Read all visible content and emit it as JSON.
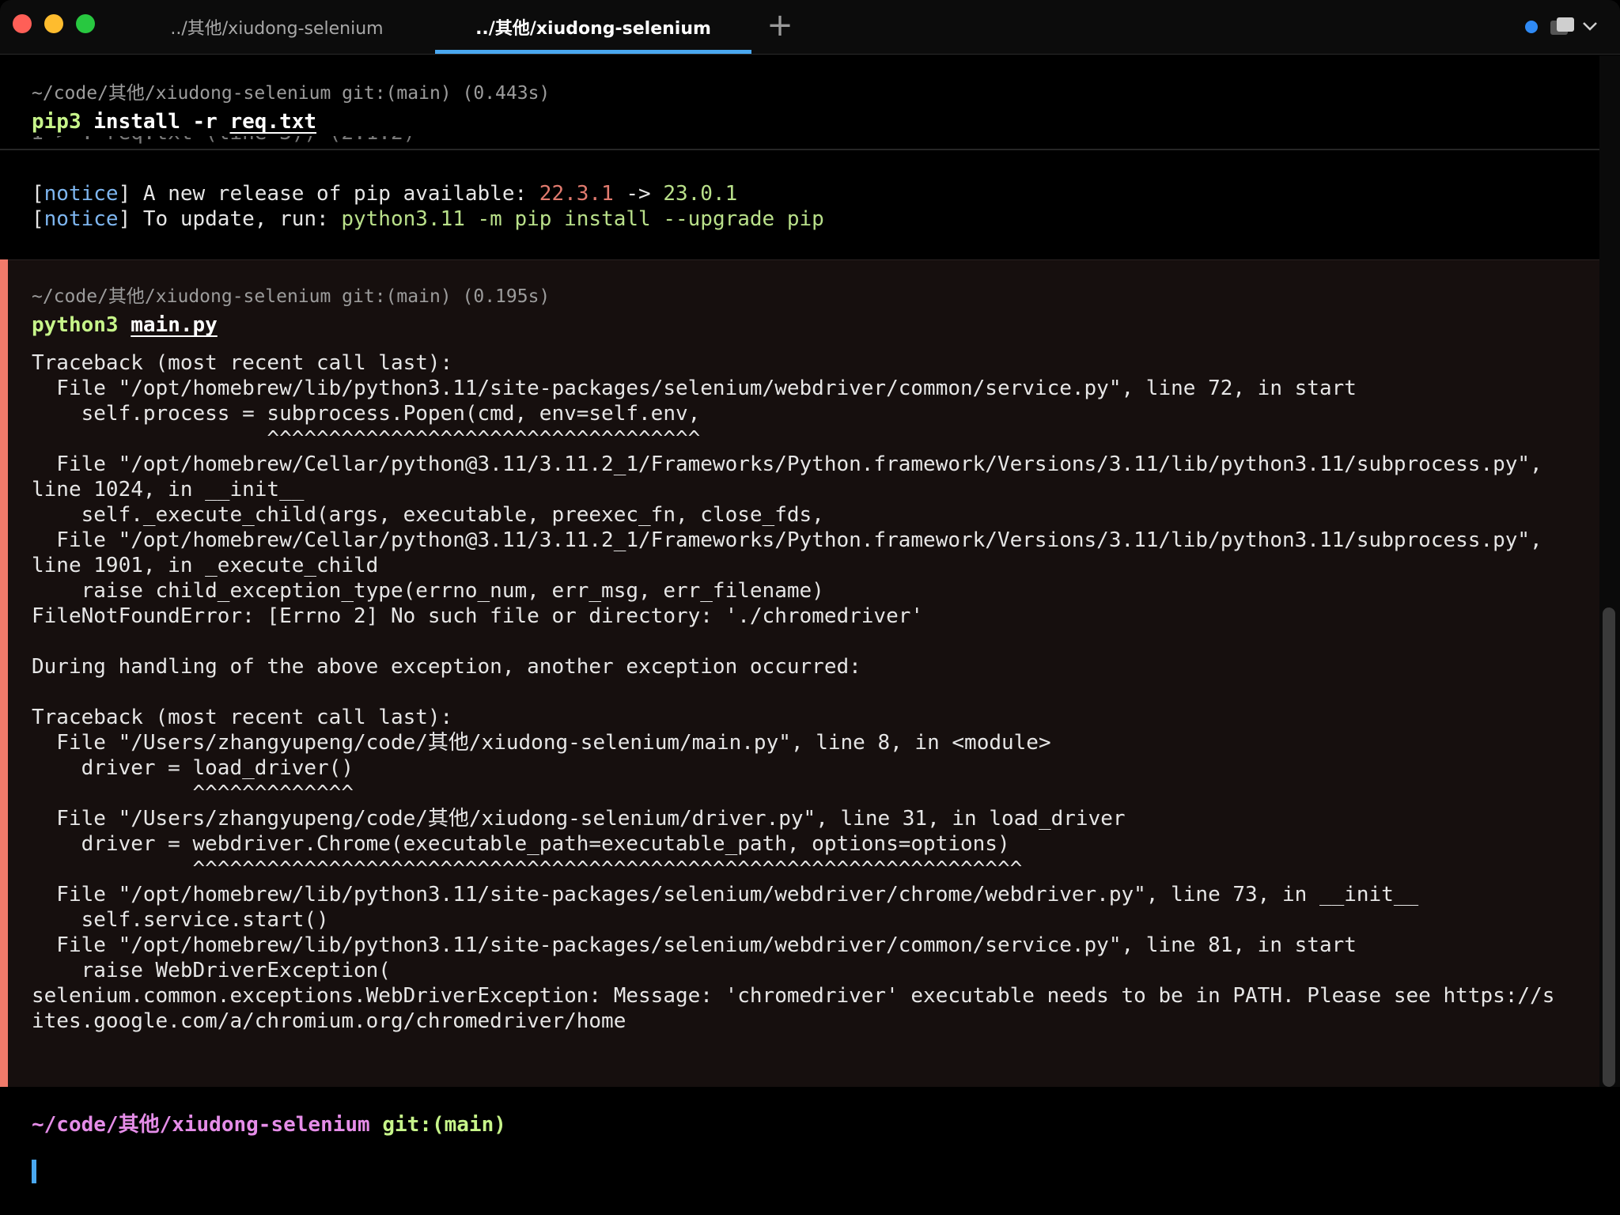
{
  "tabs": [
    {
      "label": "../其他/xiudong-selenium",
      "active": false
    },
    {
      "label": "../其他/xiudong-selenium",
      "active": true
    }
  ],
  "colors": {
    "error_bar": "#f07a6a",
    "active_tab_indicator": "#4aa8f0",
    "command": "#c7f58a",
    "prompt_path": "#e58de8"
  },
  "icons": {
    "new_tab": "+",
    "status_dot": "blue-dot-icon",
    "window_menu": "window-stack-icon",
    "dropdown": "chevron-down-icon"
  },
  "block1": {
    "meta": "~/code/其他/xiudong-selenium git:(main) (0.443s)",
    "cmd_name": "pip3",
    "cmd_args": "install -r",
    "cmd_file": "req.txt",
    "clipped_text": "I > : req.txt (line 3)) (2.1.2)",
    "notice1_prefix": "A new release of pip available: ",
    "notice_tag": "notice",
    "old_version": "22.3.1",
    "arrow": "->",
    "new_version": "23.0.1",
    "notice2_prefix": "To update, run: ",
    "update_cmd": "python3.11 -m pip install --upgrade pip"
  },
  "block2": {
    "meta": "~/code/其他/xiudong-selenium git:(main) (0.195s)",
    "cmd_name": "python3",
    "cmd_file": "main.py",
    "lines": [
      "Traceback (most recent call last):",
      "  File \"/opt/homebrew/lib/python3.11/site-packages/selenium/webdriver/common/service.py\", line 72, in start",
      "    self.process = subprocess.Popen(cmd, env=self.env,",
      "                   ^^^^^^^^^^^^^^^^^^^^^^^^^^^^^^^^^^^",
      "  File \"/opt/homebrew/Cellar/python@3.11/3.11.2_1/Frameworks/Python.framework/Versions/3.11/lib/python3.11/subprocess.py\",",
      "line 1024, in __init__",
      "    self._execute_child(args, executable, preexec_fn, close_fds,",
      "  File \"/opt/homebrew/Cellar/python@3.11/3.11.2_1/Frameworks/Python.framework/Versions/3.11/lib/python3.11/subprocess.py\",",
      "line 1901, in _execute_child",
      "    raise child_exception_type(errno_num, err_msg, err_filename)",
      "FileNotFoundError: [Errno 2] No such file or directory: './chromedriver'",
      "",
      "During handling of the above exception, another exception occurred:",
      "",
      "Traceback (most recent call last):",
      "  File \"/Users/zhangyupeng/code/其他/xiudong-selenium/main.py\", line 8, in <module>",
      "    driver = load_driver()",
      "             ^^^^^^^^^^^^^",
      "  File \"/Users/zhangyupeng/code/其他/xiudong-selenium/driver.py\", line 31, in load_driver",
      "    driver = webdriver.Chrome(executable_path=executable_path, options=options)",
      "             ^^^^^^^^^^^^^^^^^^^^^^^^^^^^^^^^^^^^^^^^^^^^^^^^^^^^^^^^^^^^^^^^^^^",
      "  File \"/opt/homebrew/lib/python3.11/site-packages/selenium/webdriver/chrome/webdriver.py\", line 73, in __init__",
      "    self.service.start()",
      "  File \"/opt/homebrew/lib/python3.11/site-packages/selenium/webdriver/common/service.py\", line 81, in start",
      "    raise WebDriverException(",
      "selenium.common.exceptions.WebDriverException: Message: 'chromedriver' executable needs to be in PATH. Please see https://s",
      "ites.google.com/a/chromium.org/chromedriver/home"
    ]
  },
  "prompt": {
    "path": "~/code/其他/xiudong-selenium",
    "git": "git:(main)"
  }
}
